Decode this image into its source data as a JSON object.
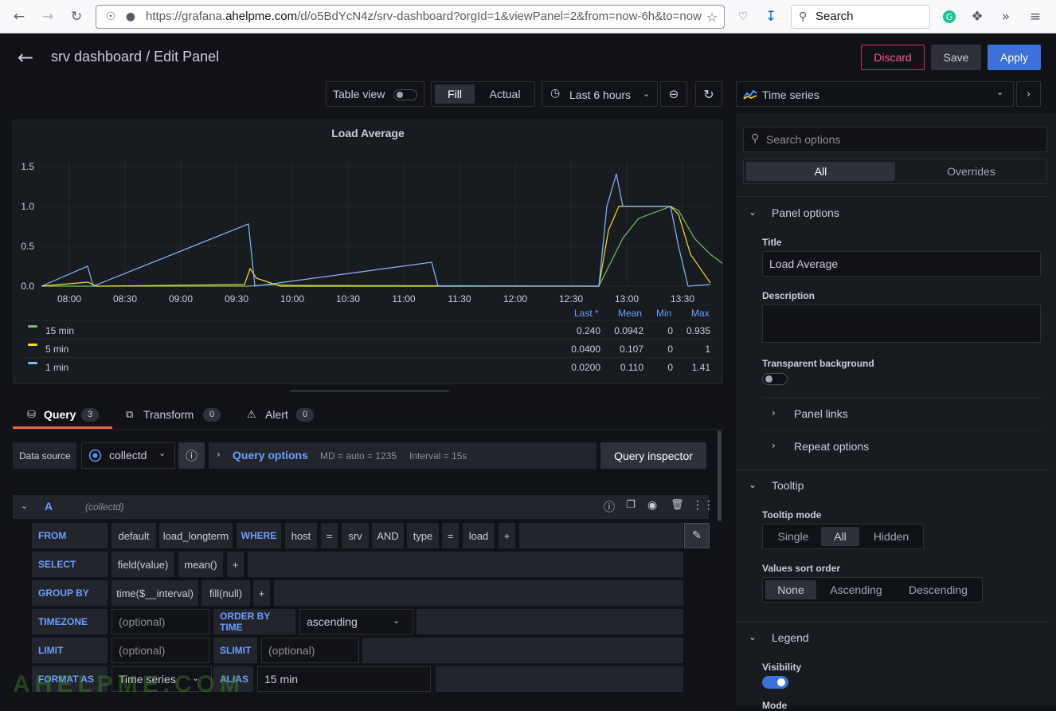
{
  "browser": {
    "url_prefix": "https://grafana.",
    "url_domain": "ahelpme.com",
    "url_rest": "/d/o5BdYcN4z/srv-dashboard?orgId=1&viewPanel=2&from=now-6h&to=now",
    "search_placeholder": "Search"
  },
  "header": {
    "title": "srv dashboard / Edit Panel",
    "discard_label": "Discard",
    "save_label": "Save",
    "apply_label": "Apply"
  },
  "toolbar": {
    "table_view_label": "Table view",
    "fill_label": "Fill",
    "actual_label": "Actual",
    "time_range": "Last 6 hours",
    "visualization": "Time series"
  },
  "chart_data": {
    "type": "line",
    "title": "Load Average",
    "ylim": [
      0,
      1.5
    ],
    "yticks": [
      "0.0",
      "0.5",
      "1.0",
      "1.5"
    ],
    "xticks": [
      "08:00",
      "08:30",
      "09:00",
      "09:30",
      "10:00",
      "10:30",
      "11:00",
      "11:30",
      "12:00",
      "12:30",
      "13:00",
      "13:30"
    ],
    "x_range": [
      "07:45",
      "13:45"
    ],
    "series": [
      {
        "name": "15 min",
        "color": "#73bf69",
        "points": [
          [
            0,
            0
          ],
          [
            260,
            0
          ],
          [
            290,
            0.02
          ],
          [
            320,
            0.01
          ],
          [
            700,
            0
          ],
          [
            715,
            0.3
          ],
          [
            730,
            0.6
          ],
          [
            750,
            0.85
          ],
          [
            790,
            1.0
          ],
          [
            800,
            0.95
          ],
          [
            820,
            0.6
          ],
          [
            840,
            0.4
          ],
          [
            860,
            0.25
          ]
        ]
      },
      {
        "name": "5 min",
        "color": "#fade2a",
        "points": [
          [
            0,
            0
          ],
          [
            58,
            0.05
          ],
          [
            70,
            0
          ],
          [
            255,
            0.02
          ],
          [
            262,
            0.22
          ],
          [
            270,
            0.1
          ],
          [
            300,
            0
          ],
          [
            700,
            0
          ],
          [
            712,
            0.7
          ],
          [
            725,
            1.0
          ],
          [
            790,
            1.0
          ],
          [
            800,
            0.9
          ],
          [
            815,
            0.4
          ],
          [
            840,
            0.04
          ]
        ]
      },
      {
        "name": "1 min",
        "color": "#8ab8ff",
        "points": [
          [
            0,
            0
          ],
          [
            58,
            0.25
          ],
          [
            65,
            0
          ],
          [
            260,
            0.78
          ],
          [
            268,
            0
          ],
          [
            490,
            0.3
          ],
          [
            498,
            0
          ],
          [
            700,
            0
          ],
          [
            710,
            1.0
          ],
          [
            722,
            1.41
          ],
          [
            730,
            1.0
          ],
          [
            790,
            1.0
          ],
          [
            800,
            0.5
          ],
          [
            812,
            0
          ],
          [
            840,
            0.02
          ]
        ]
      }
    ],
    "legend": {
      "headers": [
        "Last *",
        "Mean",
        "Min",
        "Max"
      ],
      "rows": [
        {
          "name": "15 min",
          "color": "#73bf69",
          "last": "0.240",
          "mean": "0.0942",
          "min": "0",
          "max": "0.935"
        },
        {
          "name": "5 min",
          "color": "#fade2a",
          "last": "0.0400",
          "mean": "0.107",
          "min": "0",
          "max": "1"
        },
        {
          "name": "1 min",
          "color": "#8ab8ff",
          "last": "0.0200",
          "mean": "0.110",
          "min": "0",
          "max": "1.41"
        }
      ]
    }
  },
  "tabs": {
    "query_label": "Query",
    "query_count": "3",
    "transform_label": "Transform",
    "transform_count": "0",
    "alert_label": "Alert",
    "alert_count": "0"
  },
  "query": {
    "datasource_label": "Data source",
    "datasource_value": "collectd",
    "query_options_label": "Query options",
    "md_text": "MD = auto = 1235",
    "interval_text": "Interval = 15s",
    "inspector_label": "Query inspector",
    "ref_id": "A",
    "ref_ds": "(collectd)",
    "from_label": "FROM",
    "from_policy": "default",
    "from_measurement": "load_longterm",
    "where_label": "WHERE",
    "where_key1": "host",
    "where_op1": "=",
    "where_val1": "srv",
    "and_label": "AND",
    "where_key2": "type",
    "where_op2": "=",
    "where_val2": "load",
    "plus": "+",
    "select_label": "SELECT",
    "select_field": "field(value)",
    "select_fn": "mean()",
    "groupby_label": "GROUP BY",
    "groupby_time": "time($__interval)",
    "groupby_fill": "fill(null)",
    "timezone_label": "TIMEZONE",
    "optional": "(optional)",
    "orderby_label": "ORDER BY TIME",
    "orderby_value": "ascending",
    "limit_label": "LIMIT",
    "slimit_label": "SLIMIT",
    "formatas_label": "FORMAT AS",
    "formatas_value": "Time series",
    "alias_label": "ALIAS",
    "alias_value": "15 min"
  },
  "options": {
    "search_placeholder": "Search options",
    "all_label": "All",
    "overrides_label": "Overrides",
    "panel_options": "Panel options",
    "title_label": "Title",
    "title_value": "Load Average",
    "description_label": "Description",
    "transparent_label": "Transparent background",
    "panel_links": "Panel links",
    "repeat_options": "Repeat options",
    "tooltip": "Tooltip",
    "tooltip_mode_label": "Tooltip mode",
    "tooltip_modes": [
      "Single",
      "All",
      "Hidden"
    ],
    "sort_order_label": "Values sort order",
    "sort_orders": [
      "None",
      "Ascending",
      "Descending"
    ],
    "legend": "Legend",
    "visibility_label": "Visibility",
    "mode_label": "Mode"
  },
  "watermark": "AHELPME.COM"
}
